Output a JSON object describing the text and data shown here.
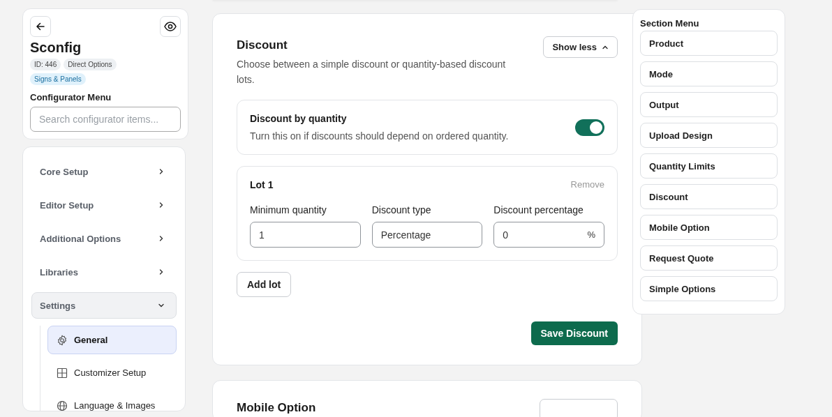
{
  "configurator": {
    "title": "Sconfig",
    "tags": [
      {
        "label": "ID: 446",
        "kind": "neutral"
      },
      {
        "label": "Direct Options",
        "kind": "neutral"
      },
      {
        "label": "Signs & Panels",
        "kind": "category"
      }
    ],
    "menu_label": "Configurator Menu",
    "search": {
      "placeholder": "Search configurator items..."
    }
  },
  "nav": [
    {
      "label": "Core Setup",
      "expanded": false
    },
    {
      "label": "Editor Setup",
      "expanded": false
    },
    {
      "label": "Additional Options",
      "expanded": false
    },
    {
      "label": "Libraries",
      "expanded": false
    },
    {
      "label": "Settings",
      "expanded": true,
      "children": [
        {
          "label": "General",
          "kind": "general",
          "selected": true
        },
        {
          "label": "Customizer Setup",
          "kind": "layout",
          "selected": false
        },
        {
          "label": "Language & Images",
          "kind": "language",
          "selected": false
        }
      ]
    }
  ],
  "discount": {
    "title": "Discount",
    "description": "Choose between a simple discount or quantity-based discount lots.",
    "collapse_button": {
      "label": "Show less",
      "expanded": true
    },
    "quantity_toggle": {
      "title": "Discount by quantity",
      "description": "Turn this on if discounts should depend on ordered quantity.",
      "on": true
    },
    "lots": [
      {
        "title": "Lot 1",
        "remove": "Remove",
        "fields": [
          {
            "label": "Minimum quantity",
            "value": "1"
          },
          {
            "label": "Discount type",
            "value": "Percentage"
          },
          {
            "label": "Discount percentage",
            "value": "0",
            "suffix": "%"
          }
        ]
      }
    ],
    "add_button": "Add lot",
    "save_button": "Save Discount"
  },
  "next_section": {
    "title": "Mobile Option"
  },
  "section_menu": {
    "title": "Section Menu",
    "items": [
      "Product",
      "Mode",
      "Output",
      "Upload Design",
      "Quantity Limits",
      "Discount",
      "Mobile Option",
      "Request Quote",
      "Simple Options"
    ]
  }
}
